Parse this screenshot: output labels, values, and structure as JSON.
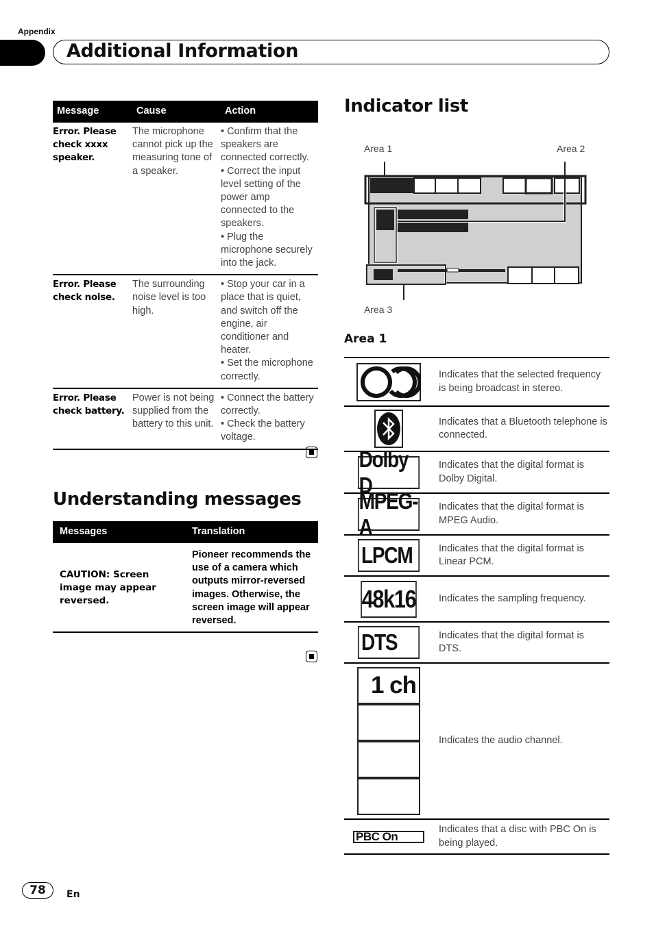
{
  "header": {
    "section": "Appendix",
    "title": "Additional Information"
  },
  "error_table": {
    "columns": [
      "Message",
      "Cause",
      "Action"
    ],
    "rows": [
      {
        "message": "Error. Please check xxxx speaker.",
        "cause": "The microphone cannot pick up the measuring tone of a speaker.",
        "action": "• Confirm that the speakers are connected correctly.\n• Correct the input level setting of the power amp connected to the speakers.\n• Plug the microphone securely into the jack."
      },
      {
        "message": "Error. Please check noise.",
        "cause": "The surrounding noise level is too high.",
        "action": "• Stop your car in a place that is quiet, and switch off the engine, air conditioner and heater.\n• Set the microphone correctly."
      },
      {
        "message": "Error. Please check battery.",
        "cause": "Power is not being supplied from the battery to this unit.",
        "action": "• Connect the battery correctly.\n• Check the battery voltage."
      }
    ]
  },
  "understanding": {
    "title": "Understanding messages",
    "columns": [
      "Messages",
      "Translation"
    ],
    "rows": [
      {
        "message": "CAUTION: Screen image may appear reversed.",
        "translation": "Pioneer recommends the use of a camera which outputs mirror-reversed images. Otherwise, the screen image will appear reversed."
      }
    ]
  },
  "indicator": {
    "title": "Indicator list",
    "diagram_labels": {
      "area1": "Area 1",
      "area2": "Area 2",
      "area3": "Area 3"
    },
    "area1_heading": "Area 1",
    "items": [
      {
        "icon": "stereo-icon",
        "label": "",
        "description": "Indicates that the selected frequency is being broadcast in stereo."
      },
      {
        "icon": "bluetooth-icon",
        "label": "",
        "description": "Indicates that a Bluetooth telephone is connected."
      },
      {
        "icon": "dolby-d-badge",
        "label": "Dolby D",
        "description": "Indicates that the digital format is Dolby Digital."
      },
      {
        "icon": "mpeg-a-badge",
        "label": "MPEG-A",
        "description": "Indicates that the digital format is MPEG Audio."
      },
      {
        "icon": "lpcm-badge",
        "label": "LPCM",
        "description": "Indicates that the digital format is Linear PCM."
      },
      {
        "icon": "sampling-badge",
        "label": "48k16",
        "description": "Indicates the sampling frequency."
      },
      {
        "icon": "dts-badge",
        "label": "DTS",
        "description": "Indicates that the digital format is DTS."
      },
      {
        "icon": "channel-badge",
        "label": "1 ch",
        "description": "Indicates the audio channel."
      },
      {
        "icon": "pbc-on-badge",
        "label": "PBC On",
        "description": "Indicates that a disc with PBC On is being played."
      }
    ]
  },
  "footer": {
    "page_number": "78",
    "language": "En"
  }
}
